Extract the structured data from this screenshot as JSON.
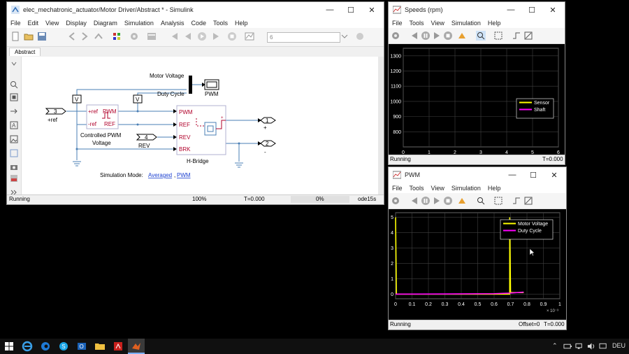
{
  "simulink": {
    "title": "elec_mechatronic_actuator/Motor Driver/Abstract * - Simulink",
    "menu": [
      "File",
      "Edit",
      "View",
      "Display",
      "Diagram",
      "Simulation",
      "Analysis",
      "Code",
      "Tools",
      "Help"
    ],
    "stop_time": "6",
    "tab": "Abstract",
    "blocks": {
      "motor_voltage_label": "Motor Voltage",
      "duty_cycle_label": "Duty Cycle",
      "pwm_scope_label": "PWM",
      "inport_num": "3",
      "inport_name": "+ref",
      "pwm_block": {
        "in1": "+ref",
        "in2": "-ref",
        "out1": "PWM",
        "out2": "REF",
        "caption_line1": "Controlled PWM",
        "caption_line2": "Voltage"
      },
      "rev_num": "4",
      "rev_name": "REV",
      "hbridge": {
        "p1": "PWM",
        "p2": "REF",
        "p3": "REV",
        "p4": "BRK",
        "caption": "H-Bridge"
      },
      "out1_num": "1",
      "out1_name": "+",
      "out2_num": "2",
      "out2_name": "-",
      "v_label": "V"
    },
    "sim_mode_prefix": "Simulation Mode:",
    "sim_mode_link1": "Averaged",
    "sim_mode_link2": "PWM",
    "status": {
      "state": "Running",
      "zoom": "100%",
      "time": "T=0.000",
      "progress": "0%",
      "solver": "ode15s"
    }
  },
  "speeds": {
    "title": "Speeds (rpm)",
    "menu": [
      "File",
      "Tools",
      "View",
      "Simulation",
      "Help"
    ],
    "status": {
      "state": "Running",
      "time": "T=0.000"
    }
  },
  "pwm": {
    "title": "PWM",
    "menu": [
      "File",
      "Tools",
      "View",
      "Simulation",
      "Help"
    ],
    "status": {
      "state": "Running",
      "offset": "Offset=0",
      "time": "T=0.000"
    }
  },
  "chart_data": [
    {
      "type": "line",
      "title": "",
      "x_ticks": [
        "0",
        "1",
        "2",
        "3",
        "4",
        "5",
        "6"
      ],
      "y_ticks": [
        "800",
        "900",
        "1000",
        "1100",
        "1200",
        "1300"
      ],
      "xlim": [
        0,
        6
      ],
      "ylim": [
        700,
        1350
      ],
      "grid": true,
      "legend_placement": "right",
      "series": [
        {
          "name": "Sensor",
          "color": "#ffff00",
          "x": [],
          "y": []
        },
        {
          "name": "Shaft",
          "color": "#ff00ff",
          "x": [],
          "y": []
        }
      ]
    },
    {
      "type": "line",
      "title": "",
      "x_ticks": [
        "0",
        "0.1",
        "0.2",
        "0.3",
        "0.4",
        "0.5",
        "0.6",
        "0.7",
        "0.8",
        "0.9",
        "1"
      ],
      "x_exponent": "× 10⁻³",
      "y_ticks": [
        "0",
        "1",
        "2",
        "3",
        "4",
        "5"
      ],
      "xlim": [
        0,
        1
      ],
      "ylim": [
        -0.3,
        5.3
      ],
      "grid": true,
      "legend_placement": "top-right",
      "series": [
        {
          "name": "Motor Voltage",
          "color": "#ffff00",
          "x": [
            0,
            0,
            0.005,
            0.695,
            0.695,
            0.7,
            0.78
          ],
          "y": [
            5,
            5,
            0,
            0,
            5,
            0.1,
            0.1
          ]
        },
        {
          "name": "Duty Cycle",
          "color": "#ff00ff",
          "x": [
            0,
            0.3,
            0.6,
            0.7,
            0.78
          ],
          "y": [
            0,
            0.01,
            0.03,
            0.07,
            0.13
          ]
        }
      ]
    }
  ],
  "taskbar": {
    "lang": "DEU"
  },
  "colors": {
    "scope_bg": "#000000",
    "grid": "#404040",
    "block_red": "#b0002a",
    "line_blue": "#4a7fb5",
    "link": "#1a3fd0"
  }
}
